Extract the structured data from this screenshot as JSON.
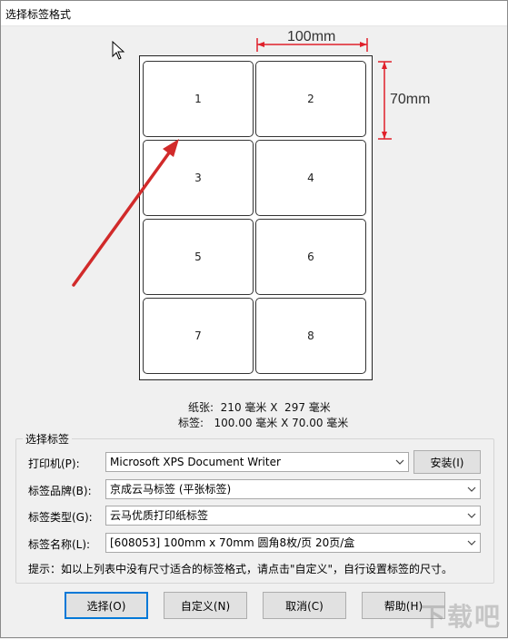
{
  "window": {
    "title": "选择标签格式"
  },
  "preview": {
    "width_label": "100mm",
    "height_label": "70mm",
    "cells": [
      "1",
      "2",
      "3",
      "4",
      "5",
      "6",
      "7",
      "8"
    ],
    "paper_info": "纸张:  210 毫米 X  297 毫米",
    "label_info": "标签:   100.00 毫米 X 70.00 毫米",
    "dimension_color": "#e0202a",
    "arrow_color": "#d12a2a"
  },
  "group": {
    "title": "选择标签",
    "printer": {
      "label": "打印机(P):",
      "value": "Microsoft XPS Document Writer"
    },
    "install_button": "安装(I)",
    "brand": {
      "label": "标签品牌(B):",
      "value": "京成云马标签 (平张标签)"
    },
    "type": {
      "label": "标签类型(G):",
      "value": "云马优质打印纸标签"
    },
    "name": {
      "label": "标签名称(L):",
      "value": "[608053] 100mm x 70mm 圆角8枚/页 20页/盒"
    }
  },
  "hint": "提示：如以上列表中没有尺寸适合的标签格式，请点击\"自定义\"，自行设置标签的尺寸。",
  "buttons": {
    "select": "选择(O)",
    "custom": "自定义(N)",
    "cancel": "取消(C)",
    "help": "帮助(H)"
  },
  "watermark": "下载吧"
}
